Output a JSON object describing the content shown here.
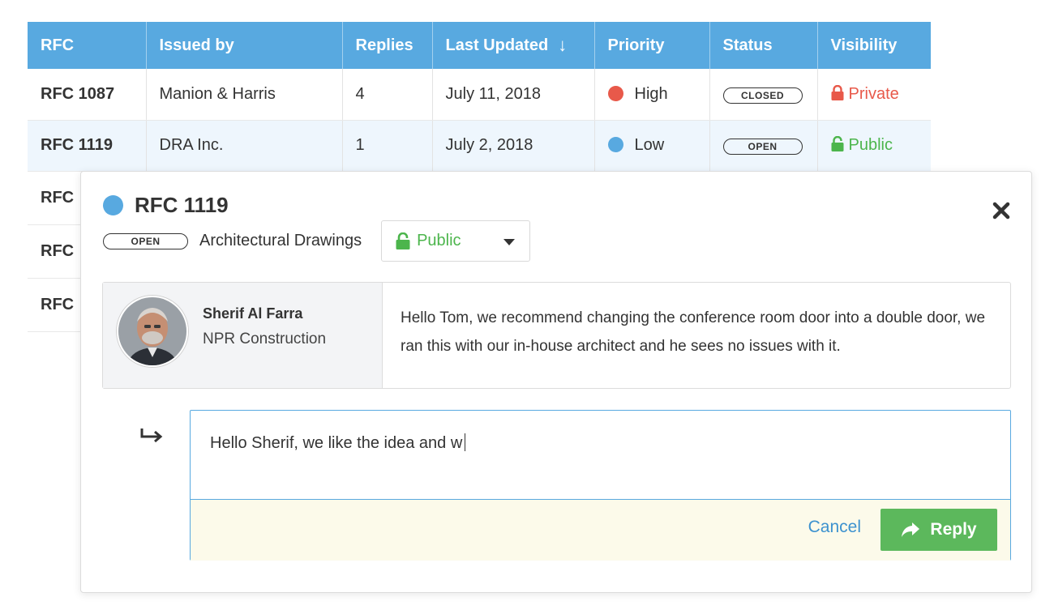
{
  "table": {
    "headers": {
      "rfc": "RFC",
      "issued_by": "Issued by",
      "replies": "Replies",
      "last_updated": "Last Updated",
      "priority": "Priority",
      "status": "Status",
      "visibility": "Visibility"
    },
    "sort_icon": "arrow-down-icon",
    "rows": [
      {
        "id": "RFC 1087",
        "issued_by": "Manion & Harris",
        "replies": "4",
        "last_updated": "July 11, 2018",
        "priority": "High",
        "priority_color": "#e8594a",
        "status": "CLOSED",
        "visibility": "Private",
        "visibility_color": "#e8594a"
      },
      {
        "id": "RFC 1119",
        "issued_by": "DRA Inc.",
        "replies": "1",
        "last_updated": "July 2, 2018",
        "priority": "Low",
        "priority_color": "#58a9e0",
        "status": "OPEN",
        "visibility": "Public",
        "visibility_color": "#4cb54c"
      },
      {
        "id": "RFC"
      },
      {
        "id": "RFC"
      },
      {
        "id": "RFC"
      }
    ]
  },
  "detail": {
    "title": "RFC 1119",
    "status": "OPEN",
    "category": "Architectural Drawings",
    "visibility": "Public",
    "message": {
      "author_name": "Sherif Al Farra",
      "author_company": "NPR Construction",
      "body": "Hello Tom, we recommend changing the conference room door into a double door, we ran this with our in-house architect and he sees no issues with it."
    },
    "reply": {
      "draft": "Hello Sherif, we like the idea and w",
      "cancel_label": "Cancel",
      "reply_label": "Reply"
    }
  },
  "colors": {
    "header_blue": "#58a9e0",
    "high": "#e8594a",
    "low": "#58a9e0",
    "public_green": "#4cb54c",
    "reply_green": "#5cb85c",
    "cancel_blue": "#3d92cf"
  }
}
